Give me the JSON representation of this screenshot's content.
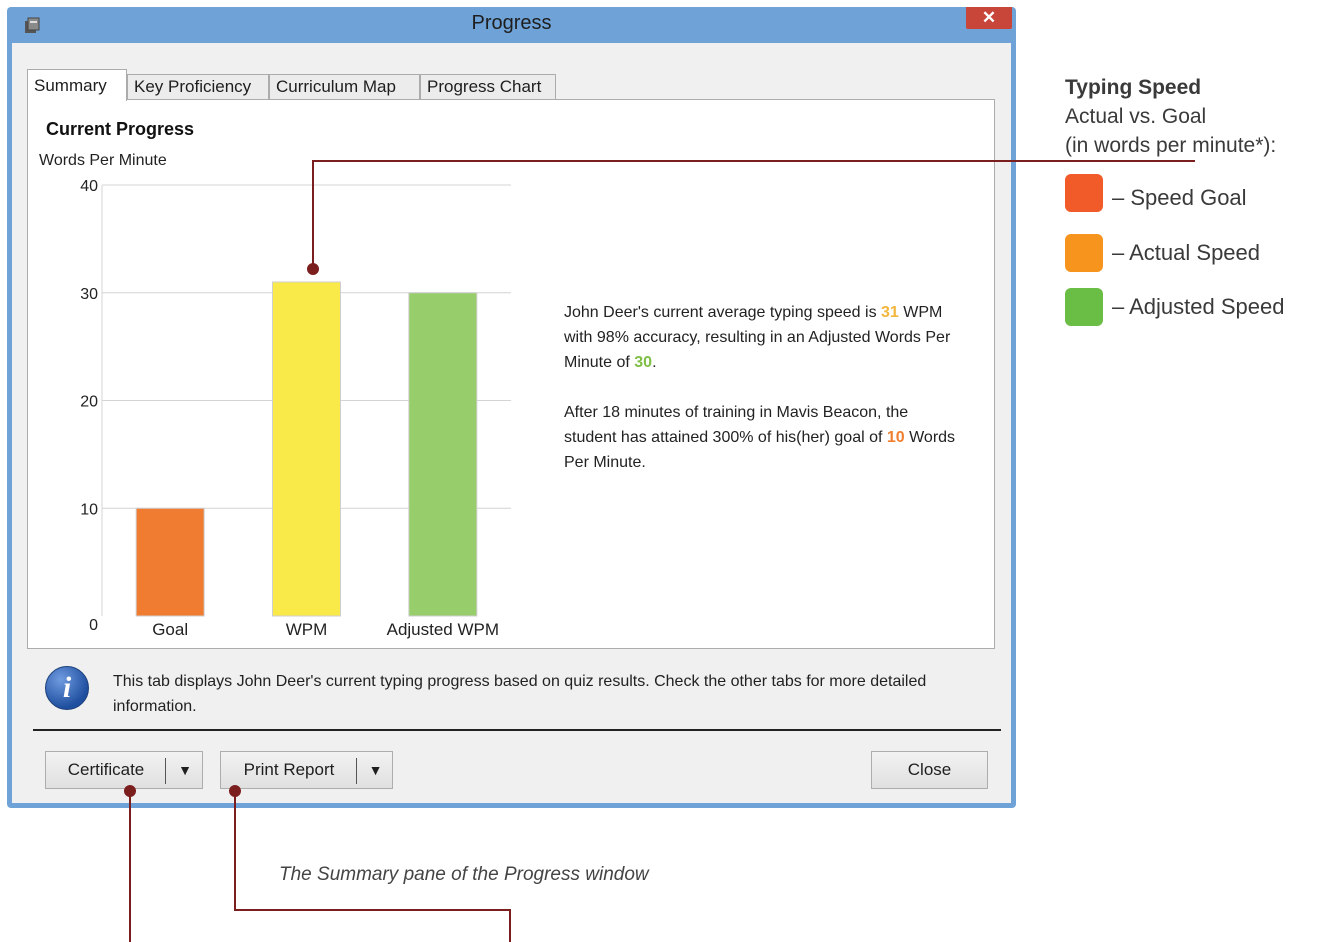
{
  "window": {
    "title": "Progress",
    "close_glyph": "✕"
  },
  "tabs": [
    {
      "label": "Summary",
      "active": true
    },
    {
      "label": "Key Proficiency",
      "active": false
    },
    {
      "label": "Curriculum Map",
      "active": false
    },
    {
      "label": "Progress Chart",
      "active": false
    }
  ],
  "summary": {
    "title": "Current Progress",
    "y_axis_label": "Words Per Minute",
    "text1_a": "John Deer's current average typing speed is ",
    "text1_wpm": "31",
    "text1_b": " WPM with 98% accuracy, resulting in an Adjusted Words Per Minute of ",
    "text1_adj": "30",
    "text1_c": ".",
    "text2_a": "After 18 minutes of training in Mavis Beacon, the student has attained 300% of his(her) goal of ",
    "text2_goal": "10",
    "text2_b": " Words Per Minute."
  },
  "chart_data": {
    "type": "bar",
    "categories": [
      "Goal",
      "WPM",
      "Adjusted WPM"
    ],
    "values": [
      10,
      31,
      30
    ],
    "colors": [
      "#f07c32",
      "#f9ea4a",
      "#97cd6a"
    ],
    "ylabel": "Words Per Minute",
    "ylim": [
      0,
      40
    ],
    "yticks": [
      0,
      10,
      20,
      30,
      40
    ],
    "grid": true
  },
  "info": {
    "icon": "info-icon",
    "text": "This tab displays John Deer's current typing progress based on quiz results. Check the other tabs for more detailed information."
  },
  "buttons": {
    "certificate": "Certificate",
    "print_report": "Print Report",
    "dropdown_glyph": "▼",
    "close": "Close"
  },
  "legend": {
    "title": "Typing Speed",
    "subtitle": "Actual vs. Goal",
    "subtitle2": "(in words per minute*):",
    "items": [
      {
        "label": "– Speed Goal",
        "color": "#f15a29"
      },
      {
        "label": "– Actual Speed",
        "color": "#f7941d"
      },
      {
        "label": "– Adjusted Speed",
        "color": "#6abd45"
      }
    ]
  },
  "caption": "The Summary pane of the Progress window",
  "callout_color": "#7b1e1e"
}
